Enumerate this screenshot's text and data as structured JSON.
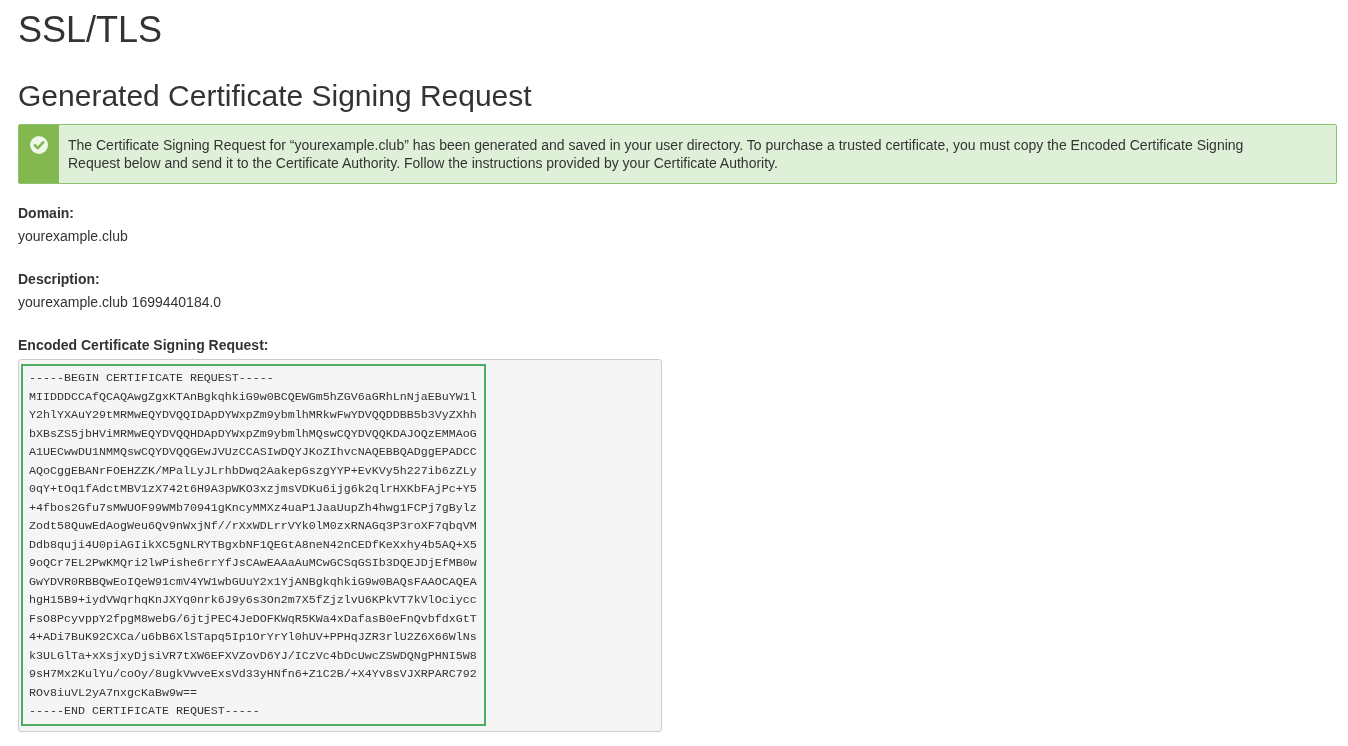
{
  "page": {
    "title": "SSL/TLS"
  },
  "section": {
    "heading": "Generated Certificate Signing Request"
  },
  "alert": {
    "kind": "success",
    "message": "The Certificate Signing Request for “yourexample.club” has been generated and saved in your user directory. To purchase a trusted certificate, you must copy the Encoded Certificate Signing Request below and send it to the Certificate Authority. Follow the instructions provided by your Certificate Authority."
  },
  "fields": [
    {
      "label": "Domain:",
      "value": "yourexample.club"
    },
    {
      "label": "Description:",
      "value": "yourexample.club 1699440184.0"
    }
  ],
  "encoded_csr": {
    "label": "Encoded Certificate Signing Request:",
    "focused": true,
    "lines": [
      "-----BEGIN CERTIFICATE REQUEST-----",
      "MIIDDDCCAfQCAQAwgZgxKTAnBgkqhkiG9w0BCQEWGm5hZGV6aGRhLnNjaEBuYW1l",
      "Y2hlYXAuY29tMRMwEQYDVQQIDApDYWxpZm9ybmlhMRkwFwYDVQQDDBB5b3VyZXhh",
      "bXBsZS5jbHViMRMwEQYDVQQHDApDYWxpZm9ybmlhMQswCQYDVQQKDAJOQzEMMAoG",
      "A1UECwwDU1NMMQswCQYDVQQGEwJVUzCCASIwDQYJKoZIhvcNAQEBBQADggEPADCC",
      "AQoCggEBANrFOEHZZK/MPalLyJLrhbDwq2AakepGszgYYP+EvKVy5h227ib6zZLy",
      "0qY+tOq1fAdctMBV1zX742t6H9A3pWKO3xzjmsVDKu6ijg6k2qlrHXKbFAjPc+Y5",
      "+4fbos2Gfu7sMWUOF99WMb70941gKncyMMXz4uaP1JaaUupZh4hwg1FCPj7gBylz",
      "Zodt58QuwEdAogWeu6Qv9nWxjNf//rXxWDLrrVYk0lM0zxRNAGq3P3roXF7qbqVM",
      "Ddb8quji4U0piAGIikXC5gNLRYTBgxbNF1QEGtA8neN42nCEDfKeXxhy4b5AQ+X5",
      "9oQCr7EL2PwKMQri2lwPishe6rrYfJsCAwEAAaAuMCwGCSqGSIb3DQEJDjEfMB0w",
      "GwYDVR0RBBQwEoIQeW91cmV4YW1wbGUuY2x1YjANBgkqhkiG9w0BAQsFAAOCAQEA",
      "hgH15B9+iydVWqrhqKnJXYq0nrk6J9y6s3On2m7X5fZjzlvU6KPkVT7kVlOciycc",
      "FsO8PcyvppY2fpgM8webG/6jtjPEC4JeDOFKWqR5KWa4xDafasB0eFnQvbfdxGtT",
      "4+ADi7BuK92CXCa/u6bB6XlSTapq5Ip1OrYrYl0hUV+PPHqJZR3rlU2Z6X66WlNs",
      "k3ULGlTa+xXsjxyDjsiVR7tXW6EFXVZovD6YJ/ICzVc4bDcUwcZSWDQNgPHNI5W8",
      "9sH7Mx2KulYu/coOy/8ugkVwveExsVd33yHNfn6+Z1C2B/+X4Yv8sVJXRPARC792",
      "ROv8iuVL2yA7nxgcKaBw9w==",
      "-----END CERTIFICATE REQUEST-----"
    ]
  }
}
